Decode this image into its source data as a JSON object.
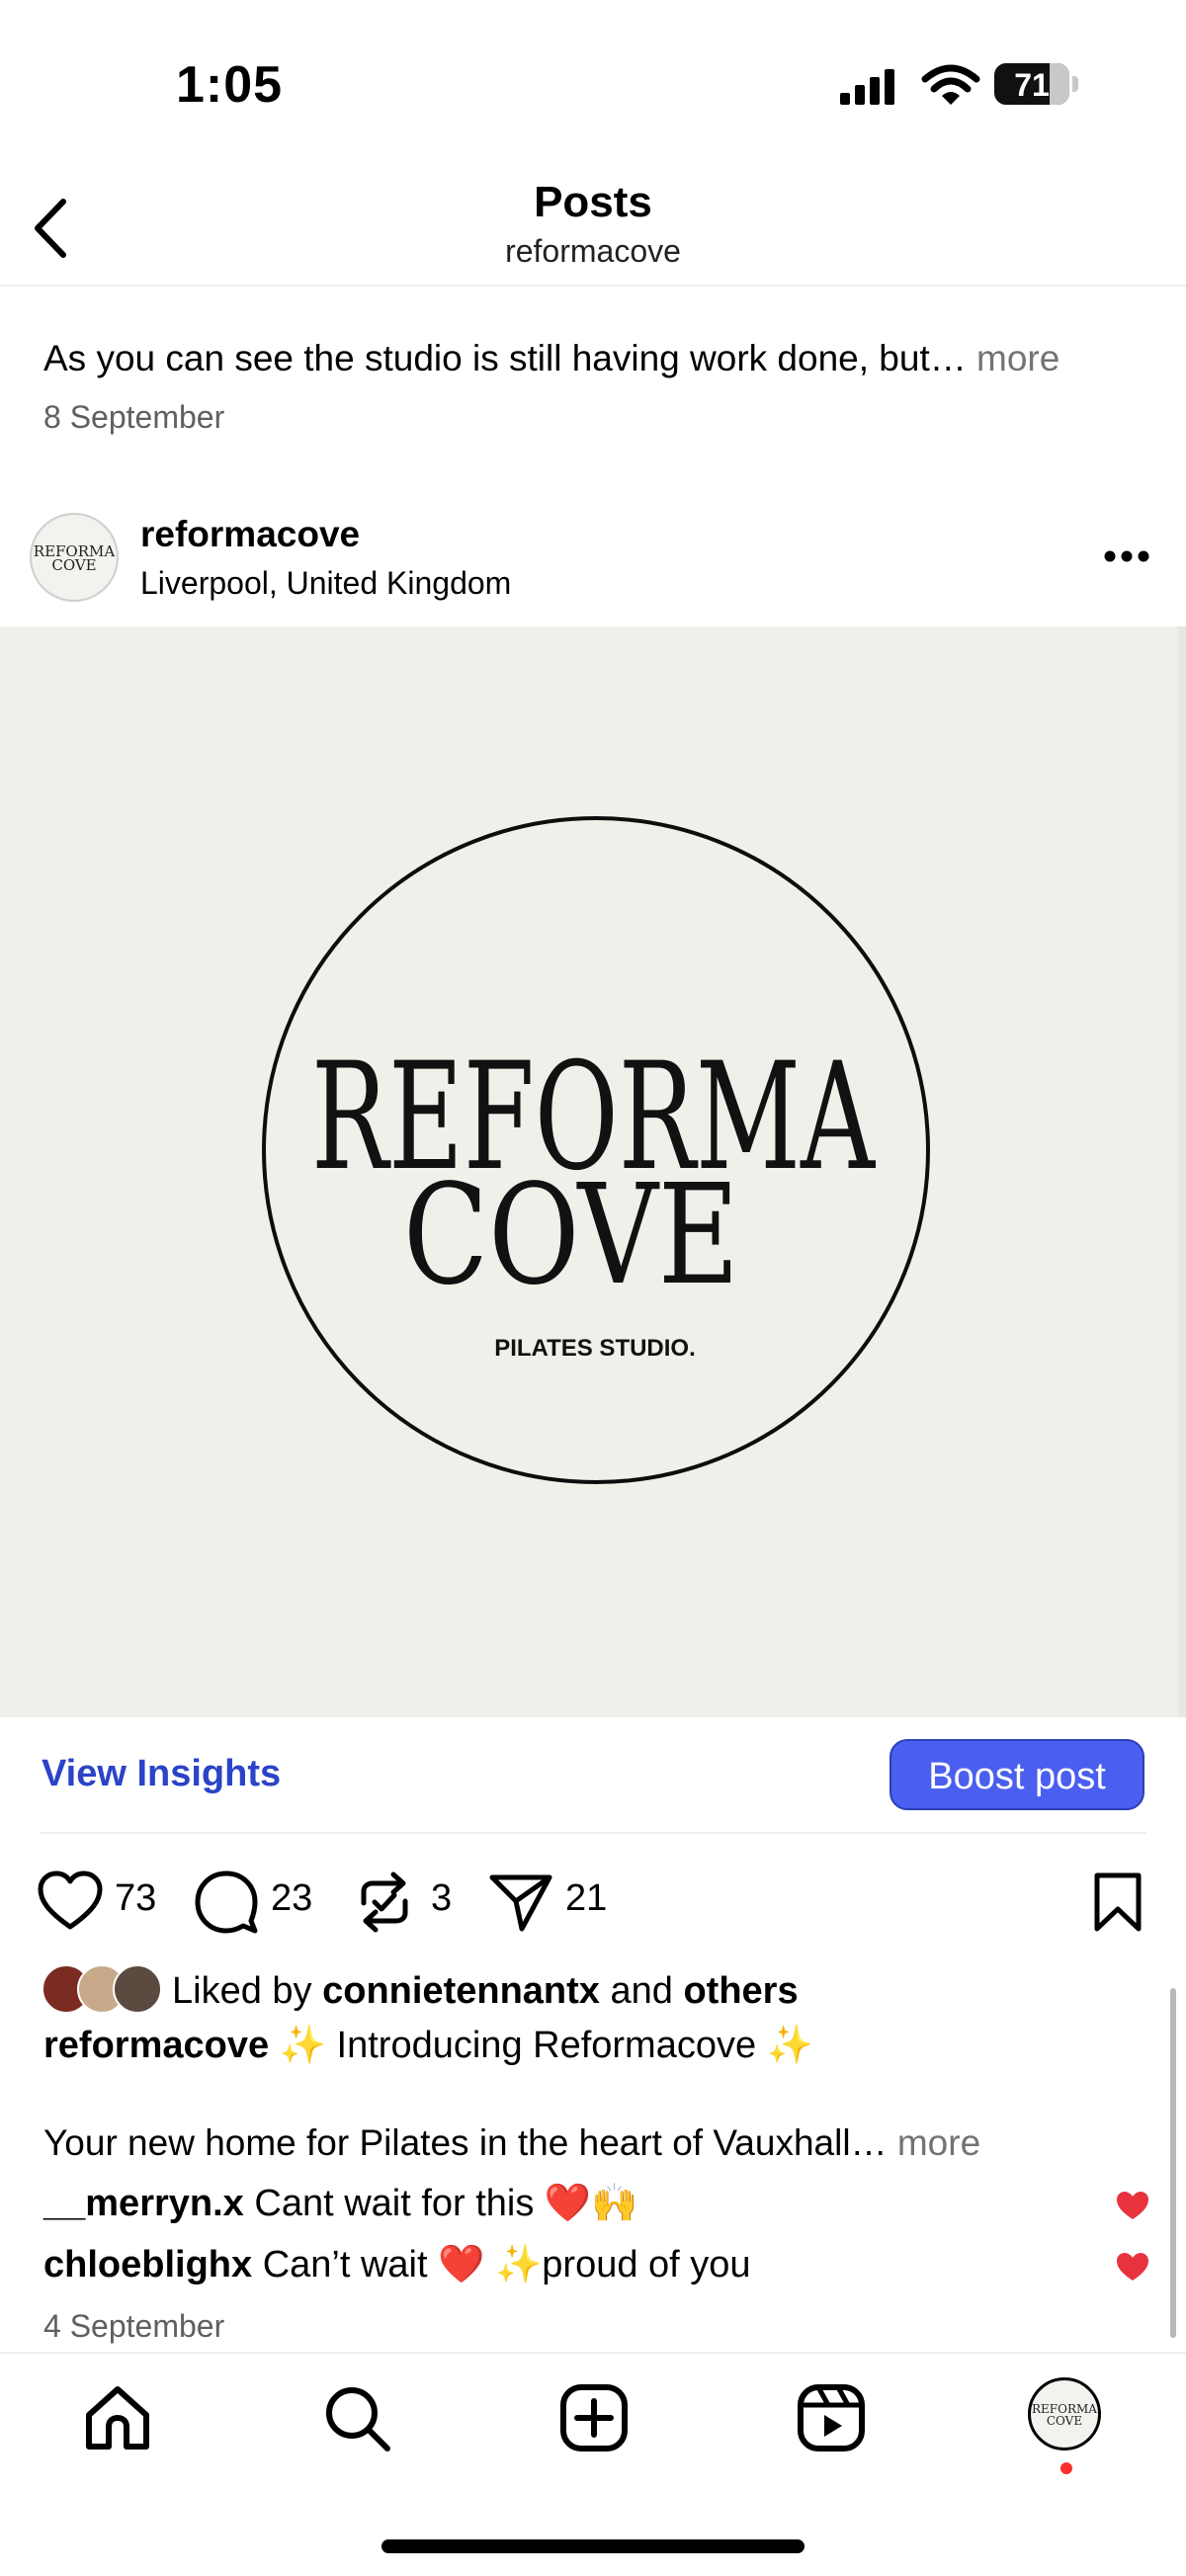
{
  "status_bar": {
    "time": "1:05",
    "battery_level": "71",
    "icons": [
      "cellular-signal-icon",
      "wifi-icon",
      "battery-icon"
    ]
  },
  "header": {
    "title": "Posts",
    "subtitle": "reformacove",
    "back_icon": "chevron-left-icon"
  },
  "previous_post": {
    "caption": "As you can see the studio is still having work done, but…",
    "more_label": "more",
    "date": "8 September"
  },
  "post": {
    "username": "reformacove",
    "location": "Liverpool, United Kingdom",
    "image": {
      "brand_line1": "REFORMA",
      "brand_line2": "COVE",
      "tagline": "PILATES STUDIO."
    },
    "avatar_text": {
      "line1": "REFORMA",
      "line2": "COVE"
    },
    "view_insights_label": "View Insights",
    "boost_label": "Boost post",
    "counts": {
      "likes": "73",
      "comments": "23",
      "reposts": "3",
      "shares": "21"
    },
    "liked_by": {
      "prefix": "Liked by",
      "user": "connietennantx",
      "middle": "and",
      "suffix": "others"
    },
    "caption_user": "reformacove",
    "caption_title": "✨ Introducing Reformacove ✨",
    "caption_body": "Your new home for Pilates in the heart of Vauxhall…",
    "caption_more": "more",
    "comments": [
      {
        "user": "__merryn.x",
        "text": "Cant wait for this ❤️🙌"
      },
      {
        "user": "chloeblighx",
        "text": "Can’t wait ❤️ ✨proud of you"
      }
    ],
    "date": "4 September"
  },
  "tab_bar": {
    "items": [
      "home-icon",
      "search-icon",
      "create-icon",
      "reels-icon",
      "profile-avatar"
    ]
  },
  "colors": {
    "link_blue": "#2a43c8",
    "boost_button": "#4a5ff0",
    "heart_red": "#e8333f",
    "image_bg": "#f0f0eb"
  }
}
